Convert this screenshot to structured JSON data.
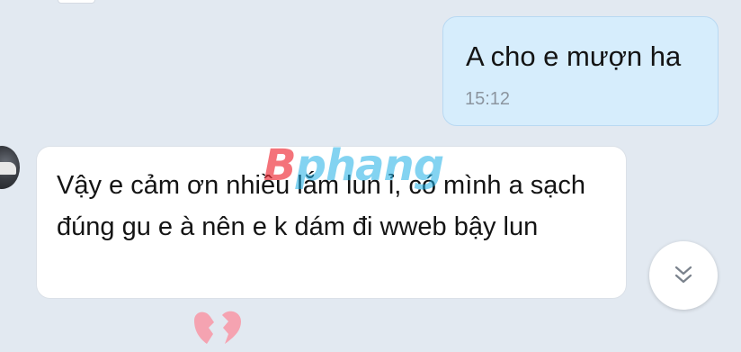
{
  "messages": {
    "outgoing": {
      "text": "A cho e mượn ha",
      "time": "15:12"
    },
    "incoming": {
      "text": "Vậy e cảm ơn nhiều lắm lun ỉ, có mình a sạch đúng gu e à nên e k dám đi wweb bậy lun"
    }
  },
  "watermark": {
    "first": "B",
    "rest": "phang"
  },
  "icons": {
    "scroll_down": "double-chevron-down-icon",
    "reaction": "broken-heart-icon",
    "avatar": "avatar"
  },
  "colors": {
    "background": "#e2e9f1",
    "outgoing_bubble": "#d6edfc",
    "incoming_bubble": "#ffffff",
    "timestamp": "#8c959f",
    "watermark_blue": "#1eafe6",
    "watermark_red": "#ee2832",
    "reaction_pink": "#f5a3b1"
  }
}
